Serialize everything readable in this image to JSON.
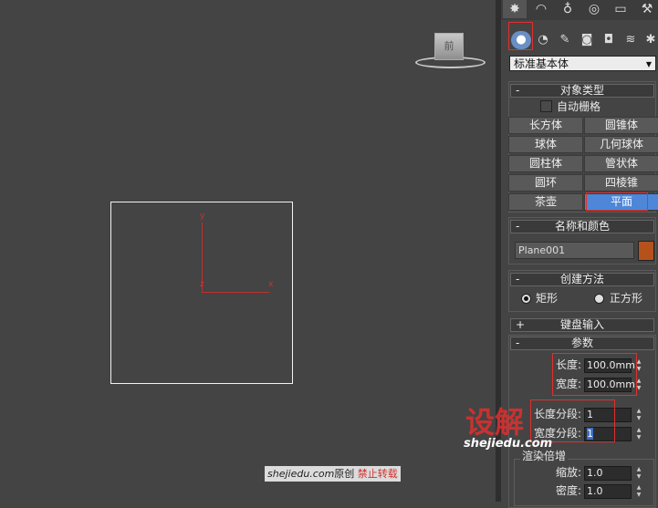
{
  "viewport": {
    "viewcube_label": "前",
    "axis_y": "y",
    "axis_z": "z",
    "axis_x": "x"
  },
  "command_panel": {
    "tabs": [
      {
        "name": "create-tab",
        "glyph": "✸"
      },
      {
        "name": "modify-tab",
        "glyph": "◠"
      },
      {
        "name": "hierarchy-tab",
        "glyph": "♁"
      },
      {
        "name": "motion-tab",
        "glyph": "◎"
      },
      {
        "name": "display-tab",
        "glyph": "▭"
      },
      {
        "name": "utilities-tab",
        "glyph": "⚒"
      }
    ],
    "subcategories": [
      {
        "name": "geometry-icon",
        "glyph": "●"
      },
      {
        "name": "shapes-icon",
        "glyph": "◔"
      },
      {
        "name": "lights-icon",
        "glyph": "✎"
      },
      {
        "name": "cameras-icon",
        "glyph": "◙"
      },
      {
        "name": "helpers-icon",
        "glyph": "◘"
      },
      {
        "name": "spacewarps-icon",
        "glyph": "≋"
      },
      {
        "name": "systems-icon",
        "glyph": "✱"
      }
    ],
    "category_dropdown": "标准基本体",
    "object_type": {
      "title": "对象类型",
      "sign": "-",
      "autogrid": "自动栅格",
      "buttons": [
        "长方体",
        "圆锥体",
        "球体",
        "几何球体",
        "圆柱体",
        "管状体",
        "圆环",
        "四棱锥",
        "茶壶",
        "平面"
      ]
    },
    "name_color": {
      "title": "名称和颜色",
      "sign": "-",
      "name_value": "Plane001",
      "color": "#b5521b"
    },
    "creation_method": {
      "title": "创建方法",
      "sign": "-",
      "option_rect": "矩形",
      "option_square": "正方形"
    },
    "keyboard_entry": {
      "title": "键盘输入",
      "sign": "+"
    },
    "parameters": {
      "title": "参数",
      "sign": "-",
      "length_label": "长度:",
      "length_value": "100.0mm",
      "width_label": "宽度:",
      "width_value": "100.0mm",
      "length_segs_label": "长度分段:",
      "length_segs_value": "1",
      "width_segs_label": "宽度分段:",
      "width_segs_value": "1",
      "render_multipliers": "渲染倍增",
      "scale_label": "缩放:",
      "scale_value": "1.0",
      "density_label": "密度:",
      "density_value": "1.0"
    }
  },
  "watermark": {
    "brand": "设解",
    "url": "shejiedu.com",
    "credit_site": "shejiedu.com",
    "credit_original": "原创",
    "credit_forbid": "禁止转载"
  }
}
